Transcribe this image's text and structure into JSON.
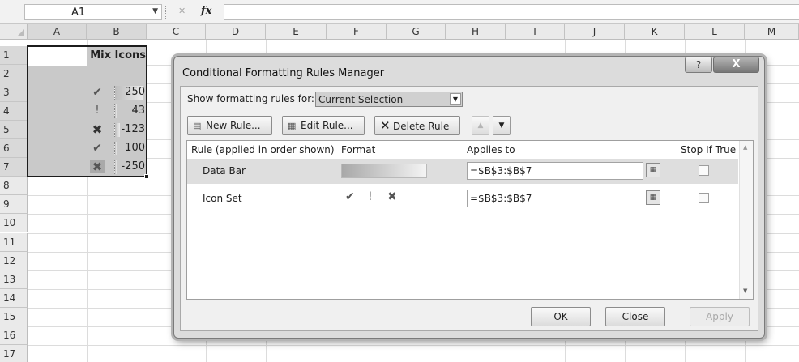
{
  "formula_bar": {
    "name_box": "A1",
    "name_box_arrow": "▼",
    "cancel_glyph": "✕",
    "fx_label": "fx",
    "formula": ""
  },
  "columns": [
    "A",
    "B",
    "C",
    "D",
    "E",
    "F",
    "G",
    "H",
    "I",
    "J",
    "K",
    "L",
    "M"
  ],
  "rows": [
    "1",
    "2",
    "3",
    "4",
    "5",
    "6",
    "7",
    "8",
    "9",
    "10",
    "11",
    "12",
    "13",
    "14",
    "15",
    "16",
    "17"
  ],
  "sheet": {
    "b1_header": "Mix Icons",
    "cells": [
      {
        "icon": "check-icon",
        "glyph": "✔",
        "value": "250",
        "bar": 1.0
      },
      {
        "icon": "exclamation-icon",
        "glyph": "!",
        "value": "43",
        "bar": 0.05
      },
      {
        "icon": "cross-icon",
        "glyph": "✖",
        "value": "-123",
        "bar": 0.2
      },
      {
        "icon": "check-icon",
        "glyph": "✔",
        "value": "100",
        "bar": 0.05
      },
      {
        "icon": "cross-icon",
        "glyph": "✖",
        "value": "-250",
        "bar": 0.0
      }
    ]
  },
  "dialog": {
    "title": "Conditional Formatting Rules Manager",
    "help_label": "?",
    "close_label": "X",
    "show_rules_label": "Show formatting rules for:",
    "show_rules_value": "Current Selection",
    "select_arrow": "▼",
    "new_rule": "New Rule...",
    "edit_rule": "Edit Rule...",
    "delete_rule": "Delete Rule",
    "move_up": "▲",
    "move_down": "▼",
    "columns": {
      "rule": "Rule (applied in order shown)",
      "format": "Format",
      "applies_to": "Applies to",
      "stop_if_true": "Stop If True"
    },
    "rules": [
      {
        "name": "Data Bar",
        "applies_to": "=$B$3:$B$7",
        "stop_if_true": false
      },
      {
        "name": "Icon Set",
        "applies_to": "=$B$3:$B$7",
        "stop_if_true": false,
        "icons": [
          "✔",
          "!",
          "✖"
        ]
      }
    ],
    "ok": "OK",
    "close": "Close",
    "apply": "Apply"
  },
  "colors": {
    "selection_border": "#1c1c1c",
    "selection_fill": "#c9c9c9",
    "dialog_bg": "#dcdcdc",
    "selected_rule_row": "#dedede"
  }
}
